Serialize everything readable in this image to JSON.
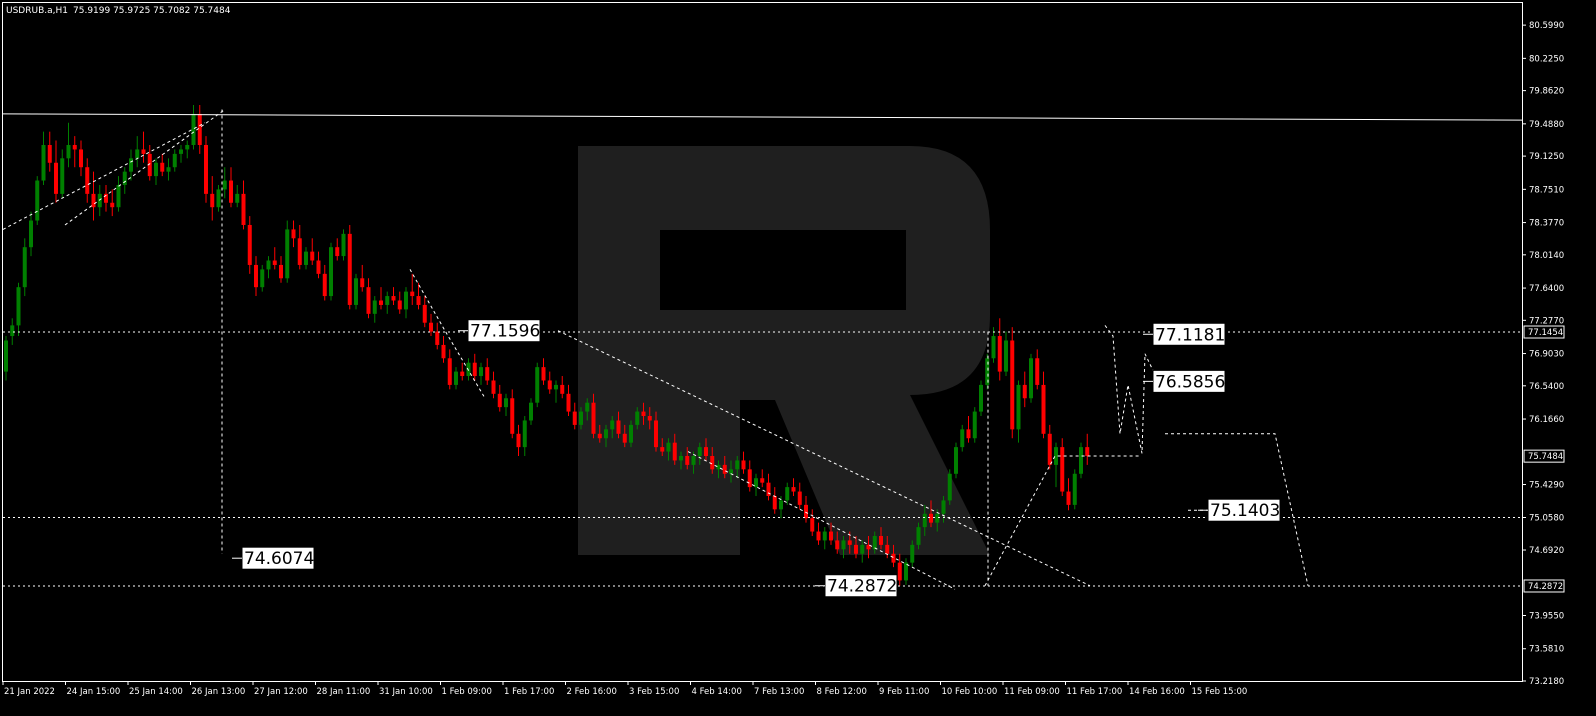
{
  "header": {
    "symbol": "USDRUB.a,H1",
    "ohlc": "75.9199 75.9725 75.7082 75.7484"
  },
  "colors": {
    "background": "#000000",
    "bull": "#008000",
    "bear": "#ff0000",
    "frame": "#ffffff",
    "watermark": "#1f1f1f",
    "callout_bg": "#ffffff",
    "callout_text": "#000000"
  },
  "watermark": "R",
  "chart_data": {
    "type": "candlestick",
    "symbol": "USDRUB.a",
    "timeframe": "H1",
    "ylim": [
      73.218,
      80.848
    ],
    "y_ticks": [
      "80.5990",
      "80.2250",
      "79.8620",
      "79.4880",
      "79.1250",
      "78.7510",
      "78.3770",
      "78.0140",
      "77.6400",
      "77.2770",
      "76.9030",
      "76.5400",
      "76.1660",
      "75.4290",
      "75.0580",
      "74.6920",
      "73.9550",
      "73.5810",
      "73.2180"
    ],
    "current_price_labels": [
      "77.1454",
      "75.7484",
      "74.2872"
    ],
    "x_labels": [
      "21 Jan 2022",
      "24 Jan 15:00",
      "25 Jan 14:00",
      "26 Jan 13:00",
      "27 Jan 12:00",
      "28 Jan 11:00",
      "31 Jan 10:00",
      "1 Feb 09:00",
      "1 Feb 17:00",
      "2 Feb 16:00",
      "3 Feb 15:00",
      "4 Feb 14:00",
      "7 Feb 13:00",
      "8 Feb 12:00",
      "9 Feb 11:00",
      "10 Feb 10:00",
      "11 Feb 09:00",
      "11 Feb 17:00",
      "14 Feb 16:00",
      "15 Feb 15:00"
    ],
    "x_label_index": [
      0,
      10,
      20,
      30,
      40,
      50,
      60,
      70,
      80,
      90,
      100,
      110,
      120,
      130,
      140,
      150,
      160,
      170,
      180,
      190
    ],
    "horizontal_levels": [
      77.1454,
      75.058,
      74.2872
    ],
    "resistance_line": [
      [
        0,
        79.6
      ],
      [
        243,
        79.53
      ]
    ],
    "callouts": [
      "77.1596",
      "74.6074",
      "74.2872",
      "77.1181",
      "76.5856",
      "75.1403"
    ],
    "candles": [
      [
        76.7,
        77.1,
        76.6,
        77.05
      ],
      [
        77.1,
        77.3,
        77.0,
        77.22
      ],
      [
        77.22,
        77.7,
        77.1,
        77.65
      ],
      [
        77.65,
        78.2,
        77.55,
        78.1
      ],
      [
        78.1,
        78.5,
        78.0,
        78.4
      ],
      [
        78.4,
        78.9,
        78.35,
        78.85
      ],
      [
        78.85,
        79.4,
        78.8,
        79.25
      ],
      [
        79.25,
        79.4,
        78.95,
        79.05
      ],
      [
        79.05,
        79.3,
        78.6,
        78.7
      ],
      [
        78.7,
        79.2,
        78.65,
        79.1
      ],
      [
        79.1,
        79.5,
        79.0,
        79.25
      ],
      [
        79.25,
        79.35,
        79.0,
        79.2
      ],
      [
        79.2,
        79.3,
        78.9,
        79.0
      ],
      [
        79.0,
        79.1,
        78.6,
        78.7
      ],
      [
        78.7,
        78.95,
        78.4,
        78.55
      ],
      [
        78.55,
        78.8,
        78.45,
        78.7
      ],
      [
        78.7,
        78.8,
        78.5,
        78.6
      ],
      [
        78.6,
        78.75,
        78.45,
        78.55
      ],
      [
        78.55,
        78.9,
        78.5,
        78.8
      ],
      [
        78.8,
        79.0,
        78.7,
        78.95
      ],
      [
        78.95,
        79.2,
        78.85,
        79.1
      ],
      [
        79.1,
        79.35,
        79.0,
        79.2
      ],
      [
        79.2,
        79.4,
        79.05,
        79.15
      ],
      [
        79.15,
        79.25,
        78.85,
        78.9
      ],
      [
        78.9,
        79.1,
        78.8,
        79.05
      ],
      [
        79.05,
        79.15,
        78.9,
        78.95
      ],
      [
        78.95,
        79.1,
        78.85,
        79.0
      ],
      [
        79.0,
        79.2,
        78.95,
        79.15
      ],
      [
        79.15,
        79.25,
        79.05,
        79.2
      ],
      [
        79.2,
        79.3,
        79.1,
        79.25
      ],
      [
        79.25,
        79.7,
        79.2,
        79.6
      ],
      [
        79.6,
        79.7,
        79.15,
        79.25
      ],
      [
        79.25,
        79.35,
        78.6,
        78.7
      ],
      [
        78.7,
        78.9,
        78.4,
        78.55
      ],
      [
        78.55,
        78.8,
        78.5,
        78.75
      ],
      [
        78.75,
        79.0,
        78.65,
        78.85
      ],
      [
        78.85,
        79.0,
        78.55,
        78.6
      ],
      [
        78.6,
        78.8,
        78.55,
        78.7
      ],
      [
        78.7,
        78.85,
        78.3,
        78.35
      ],
      [
        78.35,
        78.45,
        77.8,
        77.9
      ],
      [
        77.9,
        78.0,
        77.55,
        77.65
      ],
      [
        77.65,
        77.9,
        77.6,
        77.85
      ],
      [
        77.85,
        78.0,
        77.75,
        77.95
      ],
      [
        77.95,
        78.1,
        77.85,
        77.9
      ],
      [
        77.9,
        78.0,
        77.7,
        77.75
      ],
      [
        77.75,
        78.4,
        77.7,
        78.3
      ],
      [
        78.3,
        78.4,
        78.1,
        78.2
      ],
      [
        78.2,
        78.35,
        77.85,
        77.9
      ],
      [
        77.9,
        78.1,
        77.85,
        78.05
      ],
      [
        78.05,
        78.2,
        77.9,
        77.95
      ],
      [
        77.95,
        78.05,
        77.75,
        77.8
      ],
      [
        77.8,
        77.9,
        77.5,
        77.55
      ],
      [
        77.55,
        78.15,
        77.5,
        78.1
      ],
      [
        78.1,
        78.2,
        77.95,
        78.0
      ],
      [
        78.0,
        78.3,
        77.95,
        78.25
      ],
      [
        78.25,
        78.35,
        77.4,
        77.45
      ],
      [
        77.45,
        77.8,
        77.4,
        77.75
      ],
      [
        77.75,
        77.9,
        77.6,
        77.65
      ],
      [
        77.65,
        77.75,
        77.3,
        77.35
      ],
      [
        77.35,
        77.55,
        77.25,
        77.5
      ],
      [
        77.5,
        77.65,
        77.4,
        77.45
      ],
      [
        77.45,
        77.6,
        77.35,
        77.55
      ],
      [
        77.55,
        77.65,
        77.45,
        77.5
      ],
      [
        77.5,
        77.6,
        77.35,
        77.4
      ],
      [
        77.4,
        77.65,
        77.3,
        77.6
      ],
      [
        77.6,
        77.8,
        77.45,
        77.55
      ],
      [
        77.55,
        77.7,
        77.4,
        77.45
      ],
      [
        77.45,
        77.55,
        77.2,
        77.25
      ],
      [
        77.25,
        77.35,
        77.1,
        77.15
      ],
      [
        77.15,
        77.25,
        76.95,
        77.0
      ],
      [
        77.0,
        77.1,
        76.8,
        76.85
      ],
      [
        76.85,
        76.95,
        76.5,
        76.55
      ],
      [
        76.55,
        76.75,
        76.5,
        76.7
      ],
      [
        76.7,
        76.8,
        76.6,
        76.65
      ],
      [
        76.65,
        76.85,
        76.6,
        76.8
      ],
      [
        76.8,
        76.9,
        76.6,
        76.65
      ],
      [
        76.65,
        76.8,
        76.55,
        76.75
      ],
      [
        76.75,
        76.85,
        76.55,
        76.6
      ],
      [
        76.6,
        76.7,
        76.4,
        76.45
      ],
      [
        76.45,
        76.55,
        76.25,
        76.3
      ],
      [
        76.3,
        76.45,
        76.2,
        76.4
      ],
      [
        76.4,
        76.5,
        75.95,
        76.0
      ],
      [
        76.0,
        76.1,
        75.75,
        75.85
      ],
      [
        75.85,
        76.2,
        75.75,
        76.15
      ],
      [
        76.15,
        76.4,
        76.1,
        76.35
      ],
      [
        76.35,
        76.8,
        76.3,
        76.75
      ],
      [
        76.75,
        76.85,
        76.55,
        76.6
      ],
      [
        76.6,
        76.7,
        76.45,
        76.5
      ],
      [
        76.5,
        76.6,
        76.35,
        76.55
      ],
      [
        76.55,
        76.65,
        76.4,
        76.45
      ],
      [
        76.45,
        76.55,
        76.2,
        76.25
      ],
      [
        76.25,
        76.35,
        76.05,
        76.1
      ],
      [
        76.1,
        76.3,
        76.05,
        76.25
      ],
      [
        76.25,
        76.4,
        76.15,
        76.35
      ],
      [
        76.35,
        76.45,
        75.95,
        76.0
      ],
      [
        76.0,
        76.1,
        75.9,
        75.95
      ],
      [
        75.95,
        76.1,
        75.85,
        76.05
      ],
      [
        76.05,
        76.2,
        75.95,
        76.15
      ],
      [
        76.15,
        76.25,
        75.95,
        76.0
      ],
      [
        76.0,
        76.1,
        75.85,
        75.9
      ],
      [
        75.9,
        76.15,
        75.85,
        76.1
      ],
      [
        76.1,
        76.3,
        76.05,
        76.25
      ],
      [
        76.25,
        76.35,
        76.1,
        76.2
      ],
      [
        76.2,
        76.3,
        76.05,
        76.15
      ],
      [
        76.15,
        76.25,
        75.8,
        75.85
      ],
      [
        75.85,
        75.95,
        75.75,
        75.8
      ],
      [
        75.8,
        75.95,
        75.7,
        75.9
      ],
      [
        75.9,
        76.0,
        75.65,
        75.7
      ],
      [
        75.7,
        75.8,
        75.6,
        75.75
      ],
      [
        75.75,
        75.85,
        75.6,
        75.65
      ],
      [
        75.65,
        75.8,
        75.55,
        75.75
      ],
      [
        75.75,
        75.9,
        75.65,
        75.85
      ],
      [
        75.85,
        75.95,
        75.7,
        75.75
      ],
      [
        75.75,
        75.85,
        75.55,
        75.6
      ],
      [
        75.6,
        75.7,
        75.5,
        75.65
      ],
      [
        75.65,
        75.75,
        75.5,
        75.55
      ],
      [
        75.55,
        75.7,
        75.45,
        75.6
      ],
      [
        75.6,
        75.75,
        75.5,
        75.7
      ],
      [
        75.7,
        75.8,
        75.55,
        75.6
      ],
      [
        75.6,
        75.7,
        75.35,
        75.4
      ],
      [
        75.4,
        75.55,
        75.3,
        75.5
      ],
      [
        75.5,
        75.6,
        75.4,
        75.45
      ],
      [
        75.45,
        75.55,
        75.25,
        75.3
      ],
      [
        75.3,
        75.4,
        75.1,
        75.15
      ],
      [
        75.15,
        75.3,
        75.05,
        75.25
      ],
      [
        75.25,
        75.45,
        75.2,
        75.4
      ],
      [
        75.4,
        75.5,
        75.3,
        75.35
      ],
      [
        75.35,
        75.45,
        75.15,
        75.2
      ],
      [
        75.2,
        75.3,
        75.0,
        75.05
      ],
      [
        75.05,
        75.15,
        74.85,
        74.9
      ],
      [
        74.9,
        75.0,
        74.75,
        74.8
      ],
      [
        74.8,
        74.95,
        74.7,
        74.9
      ],
      [
        74.9,
        75.0,
        74.75,
        74.8
      ],
      [
        74.8,
        74.9,
        74.65,
        74.7
      ],
      [
        74.7,
        74.85,
        74.6,
        74.8
      ],
      [
        74.8,
        74.9,
        74.65,
        74.75
      ],
      [
        74.75,
        74.85,
        74.6,
        74.65
      ],
      [
        74.65,
        74.8,
        74.55,
        74.75
      ],
      [
        74.75,
        74.85,
        74.6,
        74.7
      ],
      [
        74.7,
        74.9,
        74.65,
        74.85
      ],
      [
        74.85,
        74.95,
        74.7,
        74.75
      ],
      [
        74.75,
        74.85,
        74.6,
        74.65
      ],
      [
        74.65,
        74.75,
        74.5,
        74.55
      ],
      [
        74.55,
        74.65,
        74.29,
        74.35
      ],
      [
        74.35,
        74.6,
        74.3,
        74.55
      ],
      [
        74.55,
        74.8,
        74.5,
        74.75
      ],
      [
        74.75,
        75.0,
        74.7,
        74.95
      ],
      [
        74.95,
        75.2,
        74.85,
        75.1
      ],
      [
        75.1,
        75.25,
        74.95,
        75.0
      ],
      [
        75.0,
        75.15,
        74.9,
        75.1
      ],
      [
        75.1,
        75.3,
        75.0,
        75.25
      ],
      [
        75.25,
        75.6,
        75.2,
        75.55
      ],
      [
        75.55,
        75.9,
        75.5,
        75.85
      ],
      [
        75.85,
        76.1,
        75.8,
        76.05
      ],
      [
        76.05,
        76.2,
        75.9,
        75.95
      ],
      [
        75.95,
        76.3,
        75.9,
        76.25
      ],
      [
        76.25,
        76.6,
        76.2,
        76.55
      ],
      [
        76.55,
        76.9,
        76.5,
        76.85
      ],
      [
        76.85,
        77.2,
        76.8,
        77.1
      ],
      [
        77.1,
        77.3,
        76.6,
        76.7
      ],
      [
        76.7,
        77.15,
        76.65,
        77.05
      ],
      [
        77.05,
        77.2,
        75.95,
        76.05
      ],
      [
        76.05,
        76.6,
        75.9,
        76.55
      ],
      [
        76.55,
        76.7,
        76.3,
        76.4
      ],
      [
        76.4,
        76.9,
        76.35,
        76.85
      ],
      [
        76.85,
        76.95,
        76.5,
        76.55
      ],
      [
        76.55,
        76.7,
        75.95,
        76.0
      ],
      [
        76.0,
        76.1,
        75.6,
        75.65
      ],
      [
        75.65,
        75.9,
        75.4,
        75.85
      ],
      [
        75.85,
        75.95,
        75.3,
        75.35
      ],
      [
        75.35,
        75.5,
        75.14,
        75.2
      ],
      [
        75.2,
        75.6,
        75.15,
        75.55
      ],
      [
        75.55,
        75.9,
        75.5,
        75.85
      ],
      [
        75.85,
        76.0,
        75.65,
        75.75
      ]
    ],
    "x_scale_start": 0,
    "forecast_path": [
      [
        229,
        79.6
      ],
      [
        224,
        79.52
      ],
      [
        226,
        74.61
      ],
      [
        260,
        77.16
      ]
    ],
    "up_trend": [
      [
        0,
        78.3
      ],
      [
        200,
        79.4
      ]
    ],
    "up_trend2": [
      [
        65,
        78.3
      ],
      [
        225,
        79.6
      ]
    ],
    "down_channel_upper": [
      [
        558,
        77.16
      ],
      [
        1090,
        74.3
      ]
    ],
    "down_channel_lower": [
      [
        688,
        75.8
      ],
      [
        955,
        74.25
      ]
    ]
  }
}
